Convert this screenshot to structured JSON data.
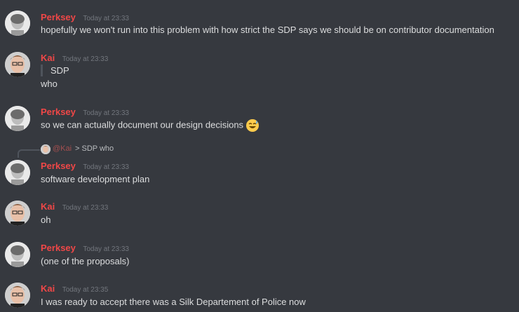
{
  "messages": [
    {
      "author": "Perksey",
      "timestamp": "Today at 23:33",
      "avatar": "perksey-avatar",
      "text": "hopefully we won't run into this problem with how strict the SDP says we should be on contributor documentation"
    },
    {
      "author": "Kai",
      "timestamp": "Today at 23:33",
      "avatar": "kai-avatar",
      "quote": "SDP",
      "text": "who"
    },
    {
      "author": "Perksey",
      "timestamp": "Today at 23:33",
      "avatar": "perksey-avatar",
      "text": "so we can actually document our design decisions",
      "emoji": "sweat-smile-emoji"
    },
    {
      "author": "Perksey",
      "timestamp": "Today at 23:33",
      "avatar": "perksey-avatar",
      "text": "software development plan",
      "reply": {
        "mention": "@Kai",
        "text": "> SDP who"
      }
    },
    {
      "author": "Kai",
      "timestamp": "Today at 23:33",
      "avatar": "kai-avatar",
      "text": "oh"
    },
    {
      "author": "Perksey",
      "timestamp": "Today at 23:33",
      "avatar": "perksey-avatar",
      "text": "(one of the proposals)"
    },
    {
      "author": "Kai",
      "timestamp": "Today at 23:35",
      "avatar": "kai-avatar",
      "text": "I was ready to accept there was a Silk Departement of Police now"
    }
  ],
  "colors": {
    "background": "#36393f",
    "username": "#f04747",
    "timestamp": "#72767d",
    "text": "#dcddde"
  }
}
